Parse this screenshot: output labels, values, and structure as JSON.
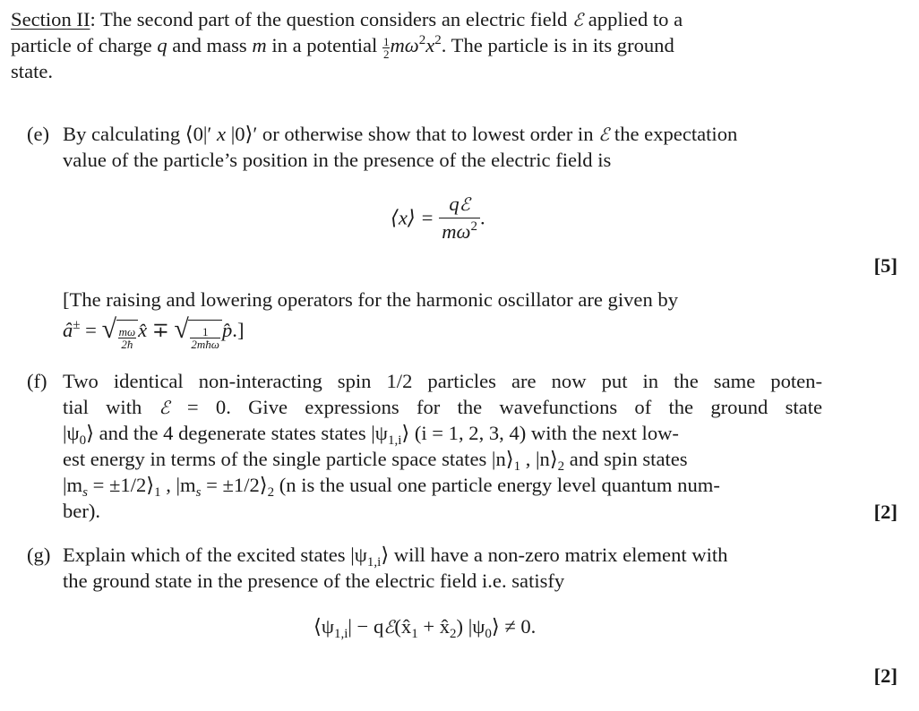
{
  "section": {
    "heading": "Section II",
    "heading_colon": ":",
    "intro_line1_a": " The second part of the question considers an electric field ",
    "field_symbol": "ℰ",
    "intro_line1_b": " applied to a",
    "intro_line2_a": "particle of charge ",
    "q": "q",
    "intro_line2_b": " and mass ",
    "m": "m",
    "intro_line2_c": " in a potential ",
    "half_num": "1",
    "half_den": "2",
    "potential_rest": "mω",
    "sq": "2",
    "x": "x",
    "intro_line2_d": ".  The particle is in its ground",
    "intro_line3": "state."
  },
  "part_e": {
    "label": "(e)",
    "line1_a": "By calculating ⟨0|′ ",
    "line1_x": "x",
    "line1_b": " |0⟩′ or otherwise show that to lowest order in ",
    "line1_field": "ℰ",
    "line1_c": " the expectation",
    "line2": "value of the particle’s position in the presence of the electric field is",
    "equation_lhs": "⟨x⟩ =",
    "equation_num_q": "q",
    "equation_num_field": "ℰ",
    "equation_den": "mω",
    "equation_den_sup": "2",
    "equation_end": ".",
    "marks": "[5]",
    "hint_line1": "[The raising and lowering operators for the harmonic oscillator are given by",
    "hint_lhs": "â",
    "hint_lhs_sup": "±",
    "hint_eq": " = ",
    "hint_sqrt1_num": "mω",
    "hint_sqrt1_den": "2ħ",
    "hint_x": "x̂",
    "hint_mp": " ∓ ",
    "hint_sqrt2_num": "1",
    "hint_sqrt2_den": "2mħω",
    "hint_p": "p̂",
    "hint_end": ".]"
  },
  "part_f": {
    "label": "(f)",
    "line1": "Two identical non-interacting spin 1/2 particles are now put in the same poten-",
    "line2_a": "tial with ",
    "line2_field": "ℰ",
    "line2_b": " = 0.  Give expressions for the wavefunctions of the ground state",
    "line3_a": "|ψ",
    "line3_sub0": "0",
    "line3_b": "⟩ and the 4 degenerate states states |ψ",
    "line3_sub1": "1,i",
    "line3_c": "⟩ (i = 1, 2, 3, 4) with the next low-",
    "line4_a": "est energy in terms of the single particle space states |n⟩",
    "line4_sub1": "1",
    "line4_b": " , |n⟩",
    "line4_sub2": "2",
    "line4_c": " and spin states",
    "line5_a": "|m",
    "line5_s": "s",
    "line5_b": " = ±1/2⟩",
    "line5_sub1": "1",
    "line5_c": " , |m",
    "line5_d": " = ±1/2⟩",
    "line5_sub2": "2",
    "line5_e": " (n is the usual one particle energy level quantum num-",
    "line6": "ber).",
    "marks": "[2]"
  },
  "part_g": {
    "label": "(g)",
    "line1_a": "Explain which of the excited states |ψ",
    "line1_sub": "1,i",
    "line1_b": "⟩ will have a non-zero matrix element with",
    "line2": "the ground state in the presence of the electric field i.e. satisfy",
    "eq_a": "⟨ψ",
    "eq_sub1": "1,i",
    "eq_b": "| − q",
    "eq_field": "ℰ",
    "eq_c": "(x̂",
    "eq_sub_x1": "1",
    "eq_d": " + x̂",
    "eq_sub_x2": "2",
    "eq_e": ") |ψ",
    "eq_sub0": "0",
    "eq_f": "⟩ ≠ 0.",
    "marks": "[2]"
  }
}
